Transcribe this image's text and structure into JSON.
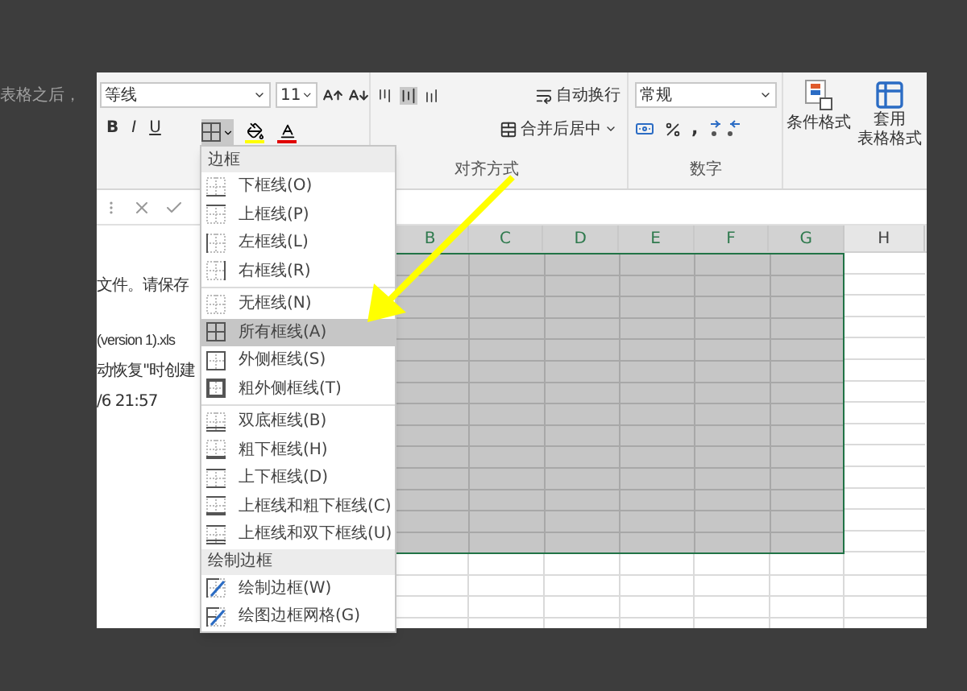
{
  "caption": "表格之后，",
  "ribbon": {
    "font_name": "等线",
    "font_size": "11",
    "style_buttons": [
      "B",
      "I",
      "U"
    ],
    "wrap_text": "自动换行",
    "merge_center": "合并后居中",
    "number_format": "常规",
    "comma": ",",
    "conditional_format": "条件格式",
    "table_format": [
      "套用",
      "表格格式"
    ],
    "group_labels": [
      "对齐方式",
      "数字"
    ]
  },
  "recovery_pane": [
    "文件。请保存",
    "(version 1).xls",
    "动恢复\"时创建",
    "/6 21:57"
  ],
  "columns": [
    {
      "label": "B",
      "selected": true
    },
    {
      "label": "C",
      "selected": true
    },
    {
      "label": "D",
      "selected": true
    },
    {
      "label": "E",
      "selected": true
    },
    {
      "label": "F",
      "selected": true
    },
    {
      "label": "G",
      "selected": true
    },
    {
      "label": "H",
      "selected": false
    }
  ],
  "border_menu": [
    {
      "header": "边框",
      "groups": [
        [
          {
            "label": "下框线(O)",
            "kind": "bottom",
            "selected": false
          },
          {
            "label": "上框线(P)",
            "kind": "top",
            "selected": false
          },
          {
            "label": "左框线(L)",
            "kind": "left",
            "selected": false
          },
          {
            "label": "右框线(R)",
            "kind": "right",
            "selected": false
          }
        ],
        [
          {
            "label": "无框线(N)",
            "kind": "none",
            "selected": false
          },
          {
            "label": "所有框线(A)",
            "kind": "all",
            "selected": true
          },
          {
            "label": "外侧框线(S)",
            "kind": "outside",
            "selected": false
          },
          {
            "label": "粗外侧框线(T)",
            "kind": "thickoutside",
            "selected": false
          }
        ],
        [
          {
            "label": "双底框线(B)",
            "kind": "doublebottom",
            "selected": false
          },
          {
            "label": "粗下框线(H)",
            "kind": "thickbottom",
            "selected": false
          },
          {
            "label": "上下框线(D)",
            "kind": "topbottom",
            "selected": false
          },
          {
            "label": "上框线和粗下框线(C)",
            "kind": "topthickbottom",
            "selected": false
          },
          {
            "label": "上框线和双下框线(U)",
            "kind": "topdoublebottom",
            "selected": false
          }
        ]
      ]
    },
    {
      "header": "绘制边框",
      "groups": [
        [
          {
            "label": "绘制边框(W)",
            "kind": "draw",
            "selected": false
          },
          {
            "label": "绘图边框网格(G)",
            "kind": "drawgrid",
            "selected": false
          }
        ]
      ]
    }
  ]
}
